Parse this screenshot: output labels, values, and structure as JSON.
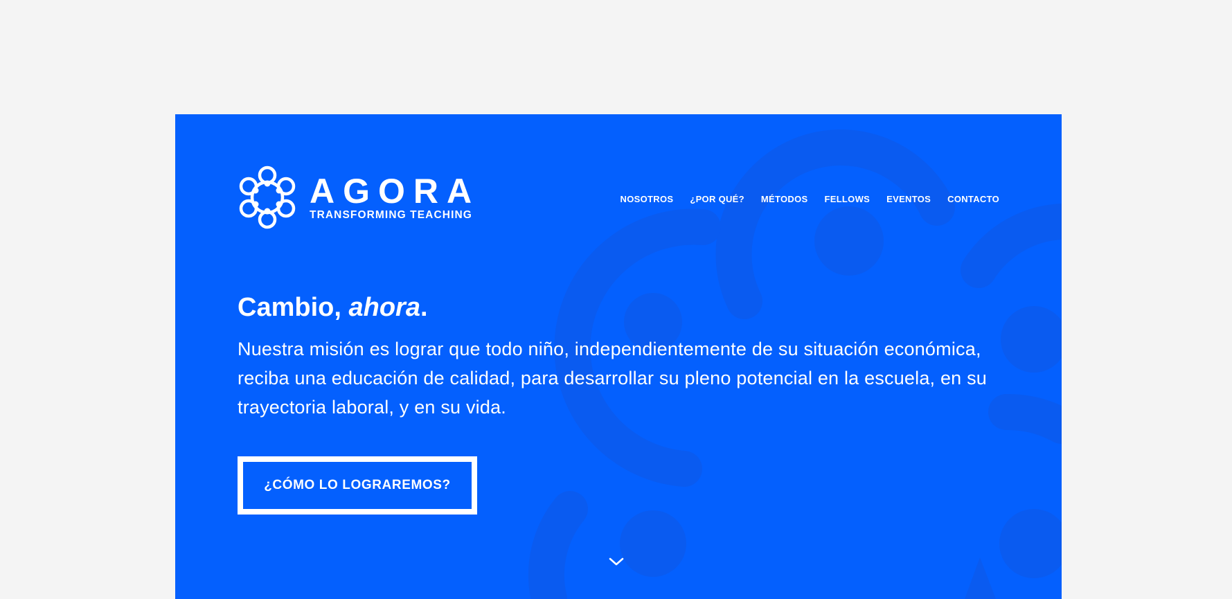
{
  "brand": {
    "name": "AGORA",
    "tagline": "TRANSFORMING TEACHING",
    "logo_icon": "agora-circle-mark"
  },
  "nav": {
    "items": [
      "NOSOTROS",
      "¿POR QUÉ?",
      "MÉTODOS",
      "FELLOWS",
      "EVENTOS",
      "CONTACTO"
    ]
  },
  "hero": {
    "title_lead": "Cambio, ",
    "title_emphasis": "ahora",
    "title_end": ".",
    "body": "Nuestra misión es lograr que todo niño, independientemente de su situación económica, reciba una educación de calidad, para desarrollar su pleno potencial en la escuela, en su trayectoria laboral, y en su vida.",
    "cta_label": "¿CÓMO LO LOGRAREMOS?",
    "scroll_icon": "chevron-down-icon"
  },
  "colors": {
    "hero_background": "#0460fe",
    "page_background": "#f4f4f4",
    "text": "#ffffff"
  }
}
